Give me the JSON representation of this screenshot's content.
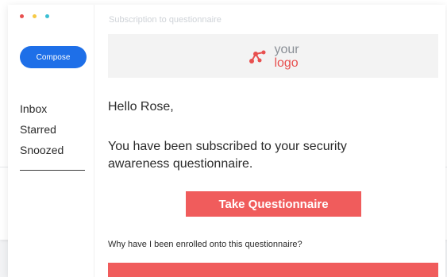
{
  "window": {
    "dot_colors": [
      "#e8504f",
      "#f6c945",
      "#3bbfd3"
    ]
  },
  "sidebar": {
    "compose_label": "Compose",
    "items": [
      {
        "label": "Inbox"
      },
      {
        "label": "Starred"
      },
      {
        "label": "Snoozed"
      }
    ]
  },
  "email": {
    "subject": "Subscription to questionnaire",
    "logo": {
      "line1": "your",
      "line2": "logo",
      "icon": "network-nodes-icon"
    },
    "greeting": "Hello Rose,",
    "body": "You have been subscribed to your security awareness questionnaire.",
    "cta_label": "Take Questionnaire",
    "question": "Why have I been enrolled onto this questionnaire?"
  },
  "colors": {
    "accent": "#f05c5c",
    "compose": "#1e6fe8"
  }
}
